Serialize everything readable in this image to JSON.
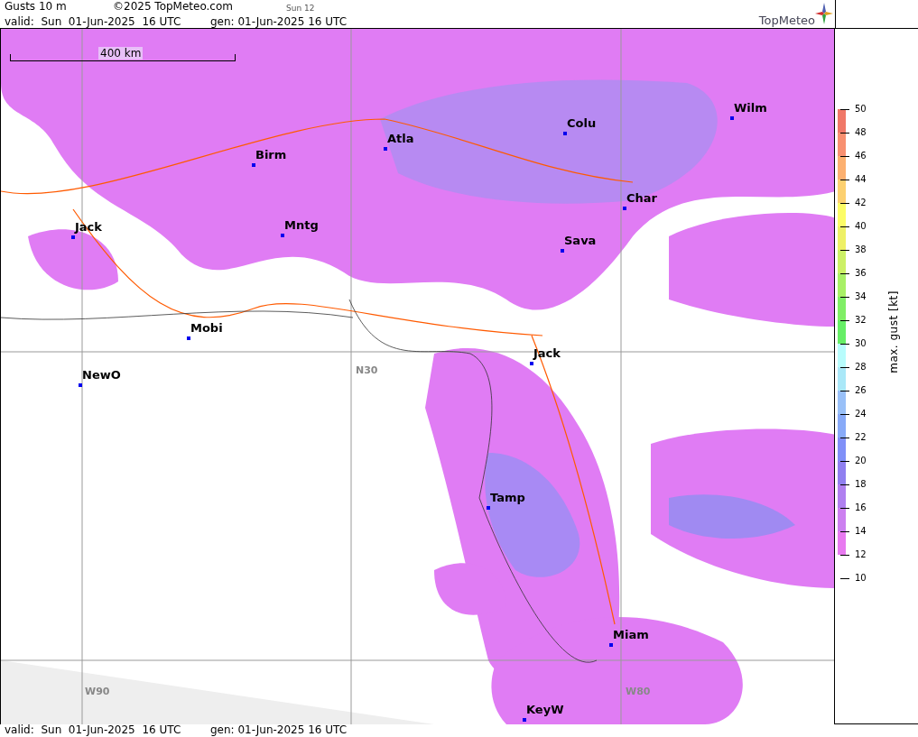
{
  "header": {
    "title": "Gusts 10 m",
    "copyright": "©2025 TopMeteo.com",
    "step": "Sun 12",
    "valid": "valid:  Sun  01-Jun-2025  16 UTC",
    "generated": "gen: 01-Jun-2025 16 UTC",
    "logo": "TopMeteo"
  },
  "map": {
    "scale": "400 km",
    "grid_labels": [
      "N30",
      "W90",
      "W80"
    ],
    "cities": [
      "Wilm",
      "Colu",
      "Atla",
      "Birm",
      "Char",
      "Mntg",
      "Jack",
      "Sava",
      "Mobi",
      "Jack",
      "NewO",
      "Tamp",
      "Miam",
      "KeyW"
    ]
  },
  "legend": {
    "title": "max. gust [kt]",
    "ticks": [
      "50",
      "48",
      "46",
      "44",
      "42",
      "40",
      "38",
      "36",
      "34",
      "32",
      "30",
      "28",
      "26",
      "24",
      "22",
      "20",
      "18",
      "16",
      "14",
      "12",
      "10"
    ],
    "bands": [
      {
        "color": "#f07868"
      },
      {
        "color": "#f89070"
      },
      {
        "color": "#fcb070"
      },
      {
        "color": "#fcd070"
      },
      {
        "color": "#fcfc66"
      },
      {
        "color": "#eef066"
      },
      {
        "color": "#ccf066"
      },
      {
        "color": "#a8f066"
      },
      {
        "color": "#80ee66"
      },
      {
        "color": "#66ee66"
      },
      {
        "color": "#b8fcfc"
      },
      {
        "color": "#aae8f8"
      },
      {
        "color": "#99c0f8"
      },
      {
        "color": "#88aaf8"
      },
      {
        "color": "#8090f8"
      },
      {
        "color": "#9080f0"
      },
      {
        "color": "#b080f0"
      },
      {
        "color": "#cc80f0"
      },
      {
        "color": "#e87af0"
      }
    ]
  },
  "footer": {
    "valid": "valid:  Sun  01-Jun-2025  16 UTC",
    "generated": "gen: 01-Jun-2025 16 UTC"
  }
}
